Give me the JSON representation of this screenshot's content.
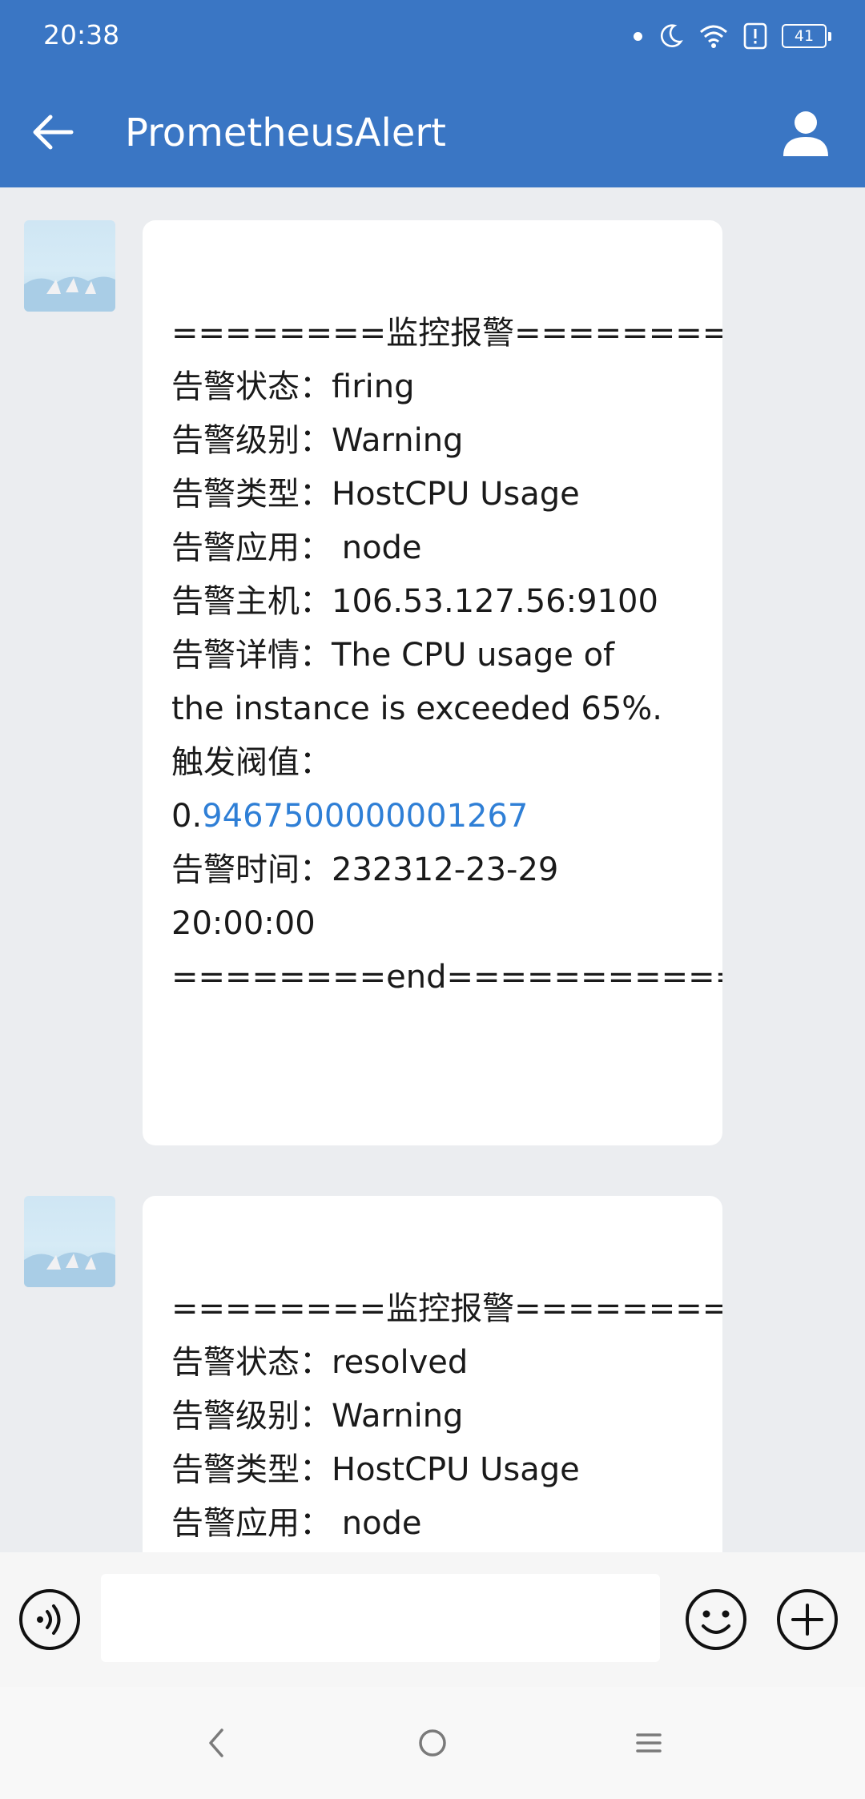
{
  "status_bar": {
    "time": "20:38",
    "battery": "41"
  },
  "app_bar": {
    "title": "PrometheusAlert"
  },
  "messages": [
    {
      "lines": [
        "========监控报警==========",
        "告警状态：firing",
        "告警级别：Warning",
        "告警类型：HostCPU Usage",
        "告警应用： node",
        "告警主机：106.53.127.56:9100",
        "告警详情：The CPU usage of",
        "the instance is exceeded 65%.",
        "触发阀值："
      ],
      "threshold_prefix": "0.",
      "threshold_link": "9467500000001267",
      "tail_lines": [
        "告警时间：232312-23-29",
        "20:00:00",
        "========end============"
      ]
    },
    {
      "lines": [
        "========监控报警==========",
        "告警状态：resolved",
        "告警级别：Warning",
        "告警类型：HostCPU Usage",
        "告警应用： node"
      ]
    }
  ],
  "composer": {
    "placeholder": ""
  },
  "icons": {
    "back": "arrow-left-icon",
    "profile": "user-icon",
    "voice": "voice-icon",
    "emoji": "smile-icon",
    "plus": "plus-icon"
  },
  "colors": {
    "app_bar": "#3a76c4",
    "link": "#2f7fd6",
    "background": "#ebedf0"
  }
}
